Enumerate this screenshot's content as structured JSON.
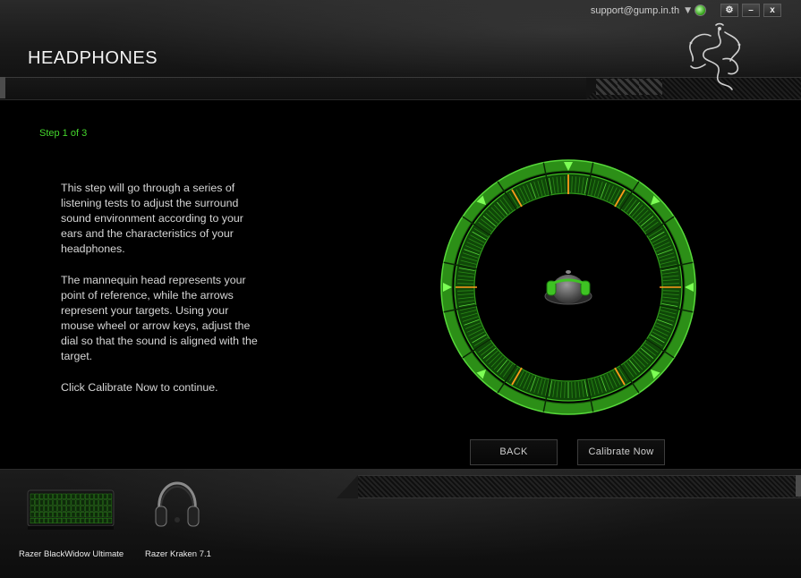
{
  "header": {
    "title": "HEADPHONES",
    "account_email": "support@gump.in.th",
    "logo_icon": "razer-snake-logo-icon",
    "window_controls": [
      "⚙",
      "–",
      "x"
    ]
  },
  "main": {
    "step_label": "Step 1 of 3",
    "paragraphs": [
      "This step will go through a series of listening tests to adjust the surround sound environment according to your ears and the characteristics of your headphones.",
      "The mannequin head represents your point of reference, while the arrows represent your targets. Using your mouse wheel or arrow keys, adjust the dial so that the sound is aligned with the target.",
      "Click Calibrate Now to continue."
    ],
    "buttons": {
      "back_label": "BACK",
      "calibrate_label": "Calibrate Now"
    }
  },
  "devices": [
    {
      "name": "Razer BlackWidow Ultimate",
      "icon": "keyboard-icon"
    },
    {
      "name": "Razer Kraken 7.1",
      "icon": "headset-icon"
    }
  ],
  "colors": {
    "accent_green": "#44d62c",
    "target_orange": "#ff9a1a",
    "background": "#000000"
  }
}
